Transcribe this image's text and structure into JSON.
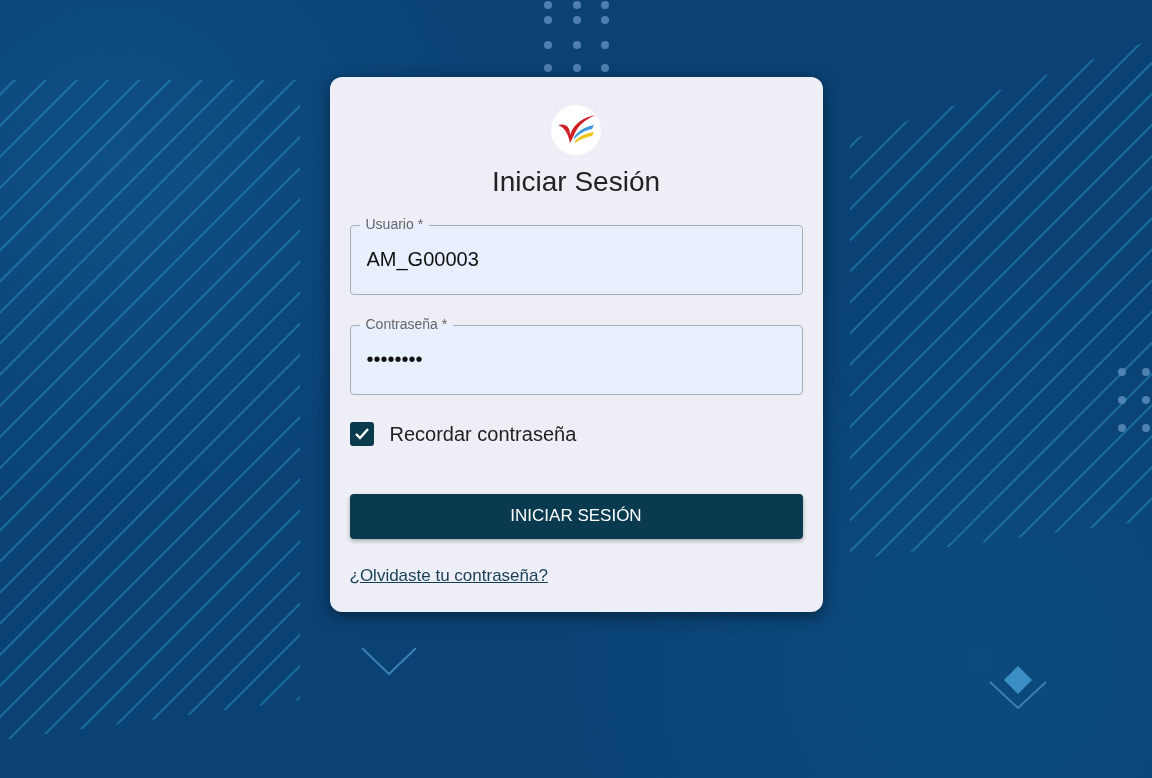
{
  "login_card": {
    "title": "Iniciar Sesión",
    "fields": [
      {
        "label": "Usuario *",
        "value": "AM_G00003"
      },
      {
        "label": "Contraseña *",
        "value": "••••••••"
      }
    ],
    "remember": {
      "label": "Recordar contraseña",
      "checked": true
    },
    "submit_button": "INICIAR SESIÓN",
    "forgot_link": "¿Olvidaste tu contraseña?"
  }
}
